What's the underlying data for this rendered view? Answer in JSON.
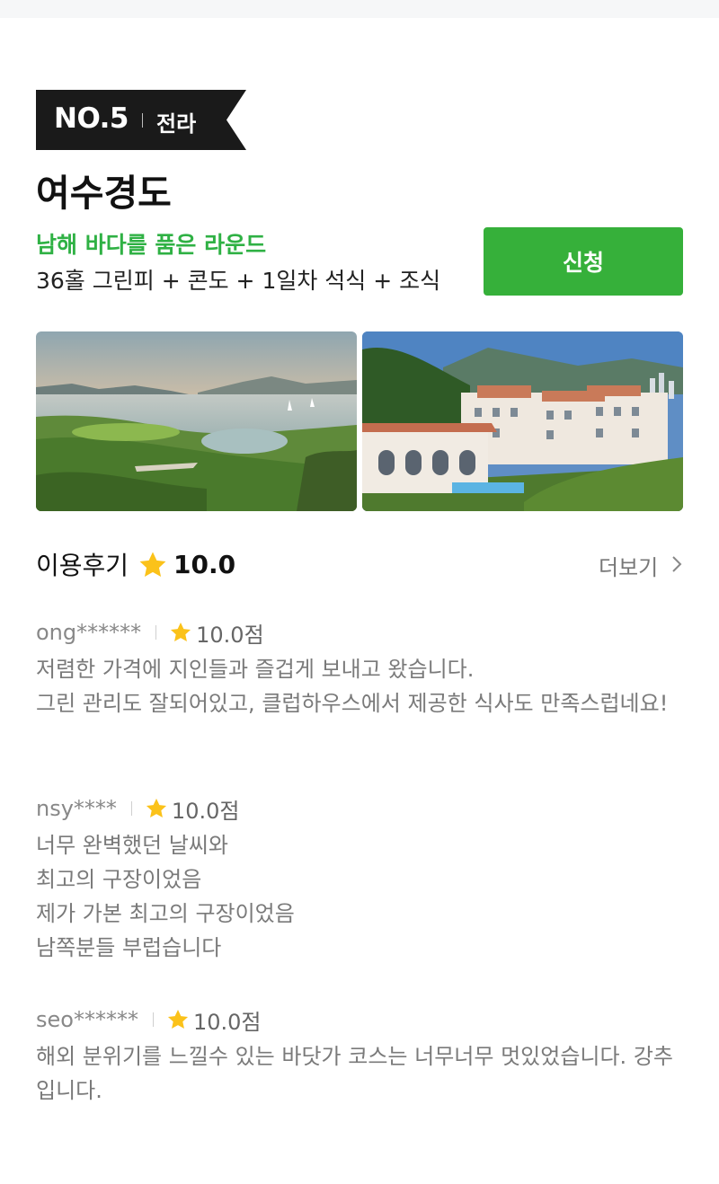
{
  "rank": {
    "label": "NO.5",
    "region": "전라"
  },
  "course": {
    "name": "여수경도",
    "tagline": "남해 바다를 품은 라운드",
    "package": "36홀 그린피 + 콘도 + 1일차 석식 + 조식"
  },
  "apply_button": "신청",
  "photos": {
    "course_view_icon": "golf-course-photo",
    "resort_view_icon": "resort-building-photo"
  },
  "reviews": {
    "title": "이용후기",
    "average": "10.0",
    "more_label": "더보기",
    "items": [
      {
        "user": "ong******",
        "score": "10.0점",
        "text": "저렴한 가격에 지인들과 즐겁게 보내고 왔습니다.\n 그린 관리도 잘되어있고, 클럽하우스에서 제공한 식사도 만족스럽네요!"
      },
      {
        "user": "nsy****",
        "score": "10.0점",
        "text": "너무 완벽했던 날씨와\n최고의 구장이었음\n제가 가본 최고의 구장이었음\n남쪽분들 부럽습니다"
      },
      {
        "user": "seo******",
        "score": "10.0점",
        "text": "해외 분위기를 느낄수 있는 바닷가 코스는 너무너무 멋있었습니다. 강추입니다."
      }
    ]
  },
  "colors": {
    "brand_green": "#36b03a",
    "tagline_green": "#2fb144",
    "star": "#fbc21a",
    "ribbon": "#1a1a1a"
  }
}
